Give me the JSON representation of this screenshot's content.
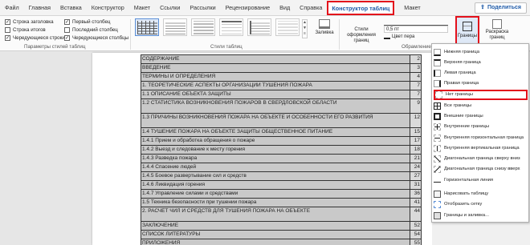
{
  "tabs": [
    "Файл",
    "Главная",
    "Вставка",
    "Конструктор",
    "Макет",
    "Ссылки",
    "Рассылки",
    "Рецензирование",
    "Вид",
    "Справка",
    "Конструктор таблиц",
    "Макет"
  ],
  "share_label": "Поделиться",
  "style_options": {
    "header_row": "Строка заголовка",
    "total_row": "Строка итогов",
    "banded_rows": "Чередующиеся строки",
    "first_column": "Первый столбец",
    "last_column": "Последний столбец",
    "banded_columns": "Чередующиеся столбцы",
    "group_label": "Параметры стилей таблиц"
  },
  "table_styles_label": "Стили таблиц",
  "shading_label": "Заливка",
  "border_styles_label": "Стили оформления границ",
  "pen_weight": "0,5 пт",
  "pen_color_label": "Цвет пера",
  "borders_label": "Границы",
  "border_painter_label": "Раскраска границ",
  "borders_group_label": "Обрамление",
  "accent_color": "#e3101b",
  "toc_rows": [
    {
      "text": "СОДЕРЖАНИЕ",
      "page": "2"
    },
    {
      "text": "ВВЕДЕНИЕ",
      "page": "3"
    },
    {
      "text": "ТЕРМИНЫ И ОПРЕДЕЛЕНИЯ",
      "page": "4"
    },
    {
      "text": "1. ТЕОРЕТИЧЕСКИЕ АСПЕКТЫ ОРГАНИЗАЦИИ ТУШЕНИЯ ПОЖАРА",
      "page": "7"
    },
    {
      "text": "1.1 ОПИСАНИЕ ОБЪЕКТА ЗАЩИТЫ",
      "page": "7"
    },
    {
      "text": "1.2 СТАТИСТИКА ВОЗНИКНОВЕНИЯ ПОЖАРОВ В СВЕРДЛОВСКОЙ ОБЛАСТИ",
      "page": "9"
    },
    {
      "text": "1.3 ПРИЧИНЫ ВОЗНИКНОВЕНИЯ ПОЖАРА НА ОБЪЕКТЕ И ОСОБЕННОСТИ ЕГО РАЗВИТИЯ",
      "page": "12"
    },
    {
      "text": "1.4 ТУШЕНИЕ ПОЖАРА НА ОБЪЕКТЕ ЗАЩИТЫ ОБЩЕСТВЕННОЕ ПИТАНИЕ",
      "page": "15"
    },
    {
      "text": "1.4.1 Прием и обработка обращения о пожаре",
      "page": "17"
    },
    {
      "text": "1.4.2 Выезд и следование к месту горения",
      "page": "18"
    },
    {
      "text": "1.4.3 Разведка пожара",
      "page": "21"
    },
    {
      "text": "1.4.4 Спасение людей",
      "page": "24"
    },
    {
      "text": "1.4.5 Боевое развертывание сил и средств",
      "page": "27"
    },
    {
      "text": "1.4.6 Ликвидация горения",
      "page": "31"
    },
    {
      "text": "1.4.7 Управление силами и средствами",
      "page": "36"
    },
    {
      "text": "1.5 Техника безопасности при тушении пожара",
      "page": "41"
    },
    {
      "text": "2. РАСЧЕТ ЧИЛ И СРЕДСТВ ДЛЯ ТУШЕНИЯ ПОЖАРА НА ОБЪЕКТЕ",
      "page": "44"
    },
    {
      "text": "ЗАКЛЮЧЕНИЕ",
      "page": "52"
    },
    {
      "text": "СПИСОК ЛИТЕРАТУРЫ",
      "page": "54"
    },
    {
      "text": "ПРИЛОЖЕНИЯ",
      "page": "55"
    }
  ],
  "borders_menu": [
    "Нижняя граница",
    "Верхняя граница",
    "Левая граница",
    "Правая граница",
    "Нет границы",
    "Все границы",
    "Внешние границы",
    "Внутренние границы",
    "Внутренняя горизонтальная граница",
    "Внутренняя вертикальная граница",
    "Диагональная граница сверху вниз",
    "Диагональная граница снизу вверх",
    "Горизонтальная линия",
    "Нарисовать таблицу",
    "Отобразить сетку",
    "Границы и заливка..."
  ]
}
